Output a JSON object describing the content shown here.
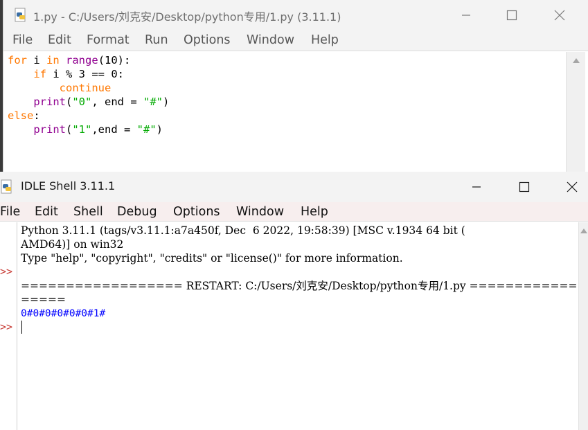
{
  "editor": {
    "title": "1.py - C:/Users/刘克安/Desktop/python专用/1.py (3.11.1)",
    "menu": [
      "File",
      "Edit",
      "Format",
      "Run",
      "Options",
      "Window",
      "Help"
    ],
    "code_lines": [
      "for i in range(10):",
      "    if i % 3 == 0:",
      "        continue",
      "    print(\"0\", end = \"#\")",
      "else:",
      "    print(\"1\",end = \"#\")"
    ]
  },
  "shell": {
    "title": "IDLE Shell 3.11.1",
    "menu": [
      "File",
      "Edit",
      "Shell",
      "Debug",
      "Options",
      "Window",
      "Help"
    ],
    "banner_line1": "Python 3.11.1 (tags/v3.11.1:a7a450f, Dec  6 2022, 19:58:39) [MSC v.1934 64 bit (",
    "banner_line2": "AMD64)] on win32",
    "banner_line3": "Type \"help\", \"copyright\", \"credits\" or \"license()\" for more information.",
    "restart_line1": "================== RESTART: C:/Users/刘克安/Desktop/python专用/1.py ============",
    "restart_line2": "=====",
    "output": "0#0#0#0#0#0#1#",
    "prompt": ">>"
  },
  "colors": {
    "keyword": "#ff7700",
    "builtin": "#900090",
    "string": "#00aa00",
    "stdout": "#0000ff",
    "prompt": "#c9403a"
  }
}
